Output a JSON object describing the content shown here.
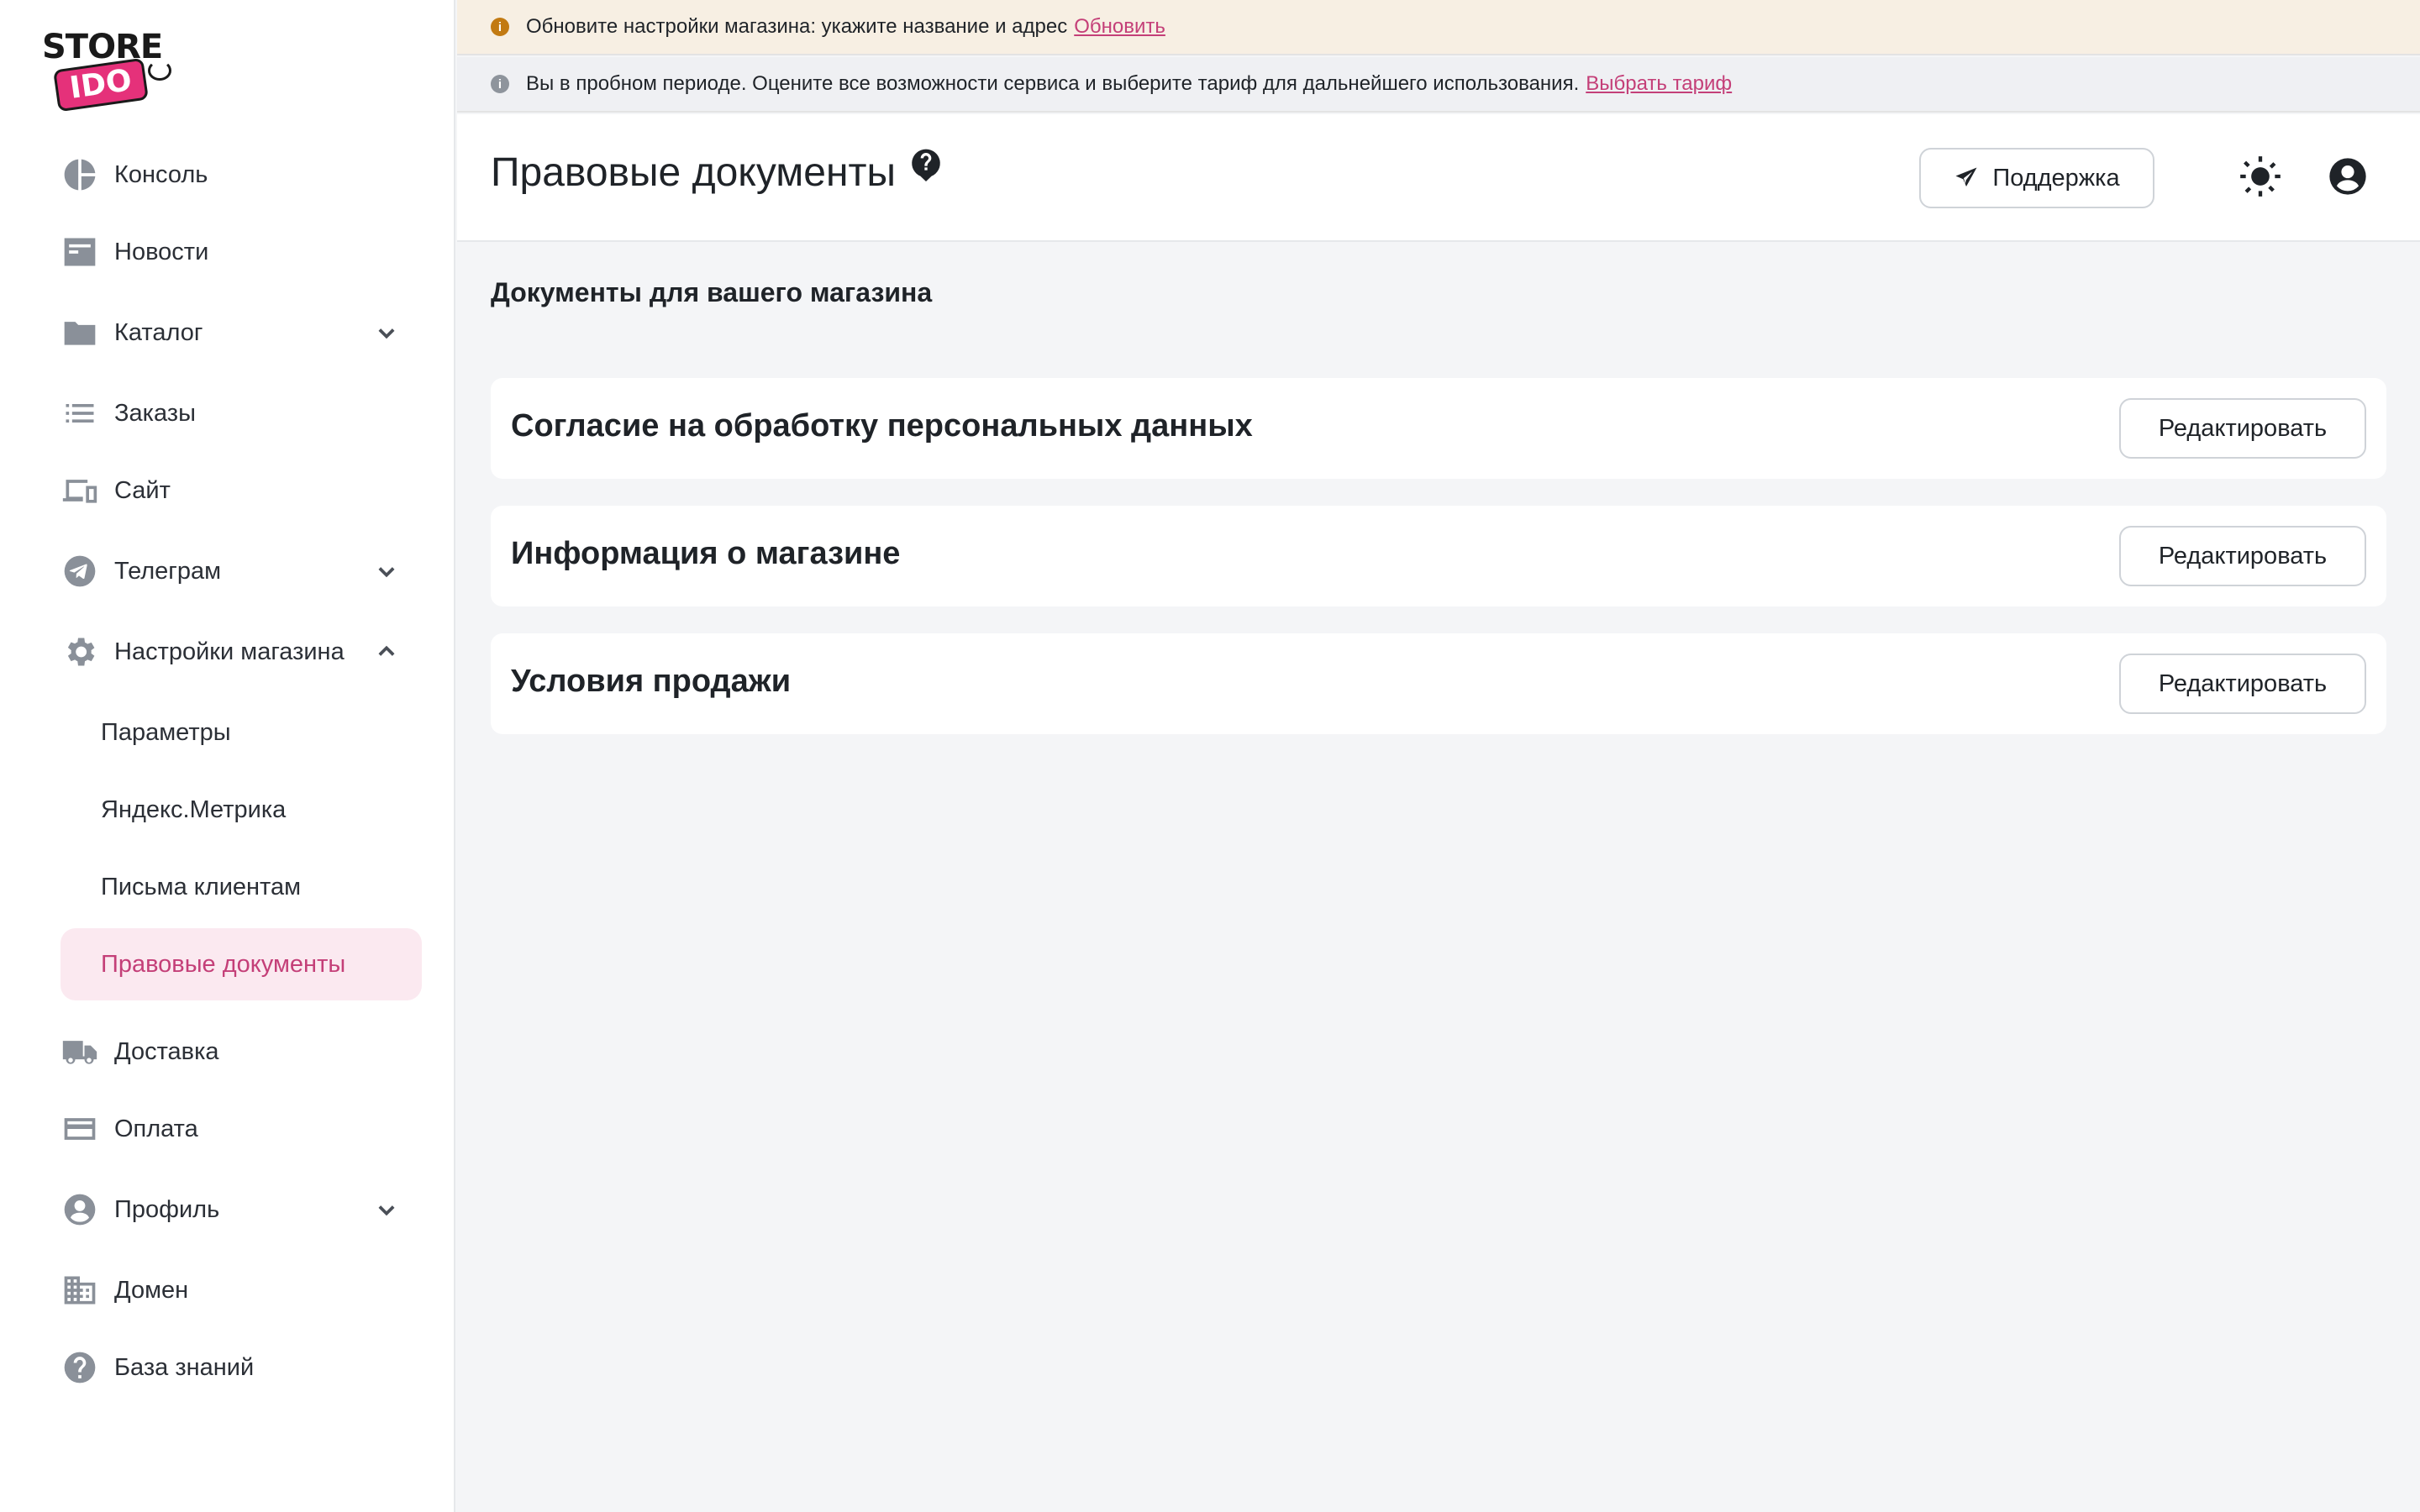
{
  "logo": {
    "line1": "STORE",
    "line2": "IDO"
  },
  "sidebar": {
    "items": [
      {
        "label": "Консоль",
        "icon": "pie-chart-icon"
      },
      {
        "label": "Новости",
        "icon": "news-icon"
      },
      {
        "label": "Каталог",
        "icon": "folder-icon",
        "chevron": "down"
      },
      {
        "label": "Заказы",
        "icon": "list-icon"
      },
      {
        "label": "Сайт",
        "icon": "devices-icon"
      },
      {
        "label": "Телеграм",
        "icon": "telegram-icon",
        "chevron": "down"
      },
      {
        "label": "Настройки магазина",
        "icon": "gear-icon",
        "chevron": "up"
      },
      {
        "label": "Доставка",
        "icon": "truck-icon"
      },
      {
        "label": "Оплата",
        "icon": "credit-card-icon"
      },
      {
        "label": "Профиль",
        "icon": "user-circle-icon",
        "chevron": "down"
      },
      {
        "label": "Домен",
        "icon": "building-icon"
      },
      {
        "label": "База знаний",
        "icon": "help-circle-icon"
      }
    ],
    "subitems": [
      {
        "label": "Параметры"
      },
      {
        "label": "Яндекс.Метрика"
      },
      {
        "label": "Письма клиентам"
      },
      {
        "label": "Правовые документы",
        "active": true
      }
    ]
  },
  "banners": {
    "warning": {
      "text": "Обновите настройки магазина: укажите название и адрес",
      "link": "Обновить"
    },
    "info": {
      "text": "Вы в пробном периоде. Оцените все возможности сервиса и выберите тариф для дальнейшего использования.",
      "link": "Выбрать тариф"
    }
  },
  "header": {
    "title": "Правовые документы",
    "support_label": "Поддержка"
  },
  "main": {
    "section_title": "Документы для вашего магазина",
    "documents": [
      {
        "title": "Согласие на обработку персональных данных",
        "action": "Редактировать"
      },
      {
        "title": "Информация о магазине",
        "action": "Редактировать"
      },
      {
        "title": "Условия продажи",
        "action": "Редактировать"
      }
    ]
  },
  "colors": {
    "accent": "#c43f78",
    "active_bg": "#fbe9f0",
    "warning_bg": "#f7efe3",
    "info_bg": "#eff0f3"
  }
}
